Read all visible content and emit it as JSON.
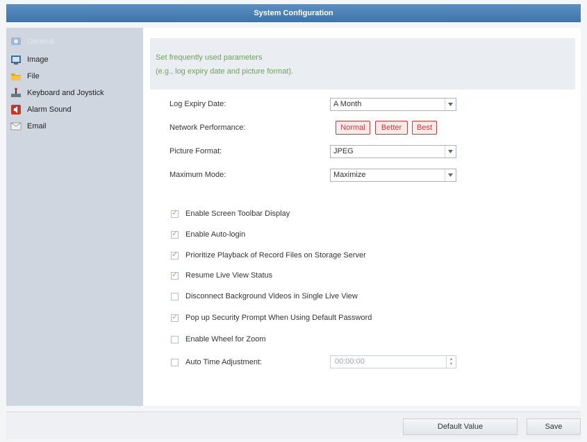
{
  "window": {
    "title": "System Configuration"
  },
  "sidebar": {
    "items": [
      {
        "label": "General",
        "icon": "general-icon",
        "selected": true
      },
      {
        "label": "Image",
        "icon": "image-icon"
      },
      {
        "label": "File",
        "icon": "folder-icon"
      },
      {
        "label": "Keyboard and Joystick",
        "icon": "keyboard-joystick-icon"
      },
      {
        "label": "Alarm Sound",
        "icon": "alarm-sound-icon"
      },
      {
        "label": "Email",
        "icon": "email-icon"
      }
    ]
  },
  "main": {
    "info_line1": "Set frequently used parameters",
    "info_line2": "(e.g., log expiry date and picture format).",
    "log_expiry": {
      "label": "Log Expiry Date:",
      "value": "A Month"
    },
    "network_performance": {
      "label": "Network Performance:",
      "options": [
        "Normal",
        "Better",
        "Best"
      ]
    },
    "picture_format": {
      "label": "Picture Format:",
      "value": "JPEG"
    },
    "maximum_mode": {
      "label": "Maximum Mode:",
      "value": "Maximize"
    },
    "checkboxes": [
      {
        "label": "Enable Screen Toolbar Display",
        "checked": true
      },
      {
        "label": "Enable Auto-login",
        "checked": true
      },
      {
        "label": "Prioritize Playback of Record Files on Storage Server",
        "checked": true
      },
      {
        "label": "Resume Live View Status",
        "checked": true
      },
      {
        "label": "Disconnect Background Videos in Single Live View",
        "checked": false
      },
      {
        "label": "Pop up Security Prompt When Using Default Password",
        "checked": true
      },
      {
        "label": "Enable Wheel for Zoom",
        "checked": false
      },
      {
        "label": "Auto Time Adjustment:",
        "checked": false
      }
    ],
    "auto_time_value": "00:00:00"
  },
  "footer": {
    "default_value_label": "Default Value",
    "save_label": "Save"
  },
  "colors": {
    "title_bar": "#3f74a9",
    "sidebar_bg": "#cfd6e0",
    "info_text": "#6fa05a",
    "perf_button": "#c23b3b"
  }
}
